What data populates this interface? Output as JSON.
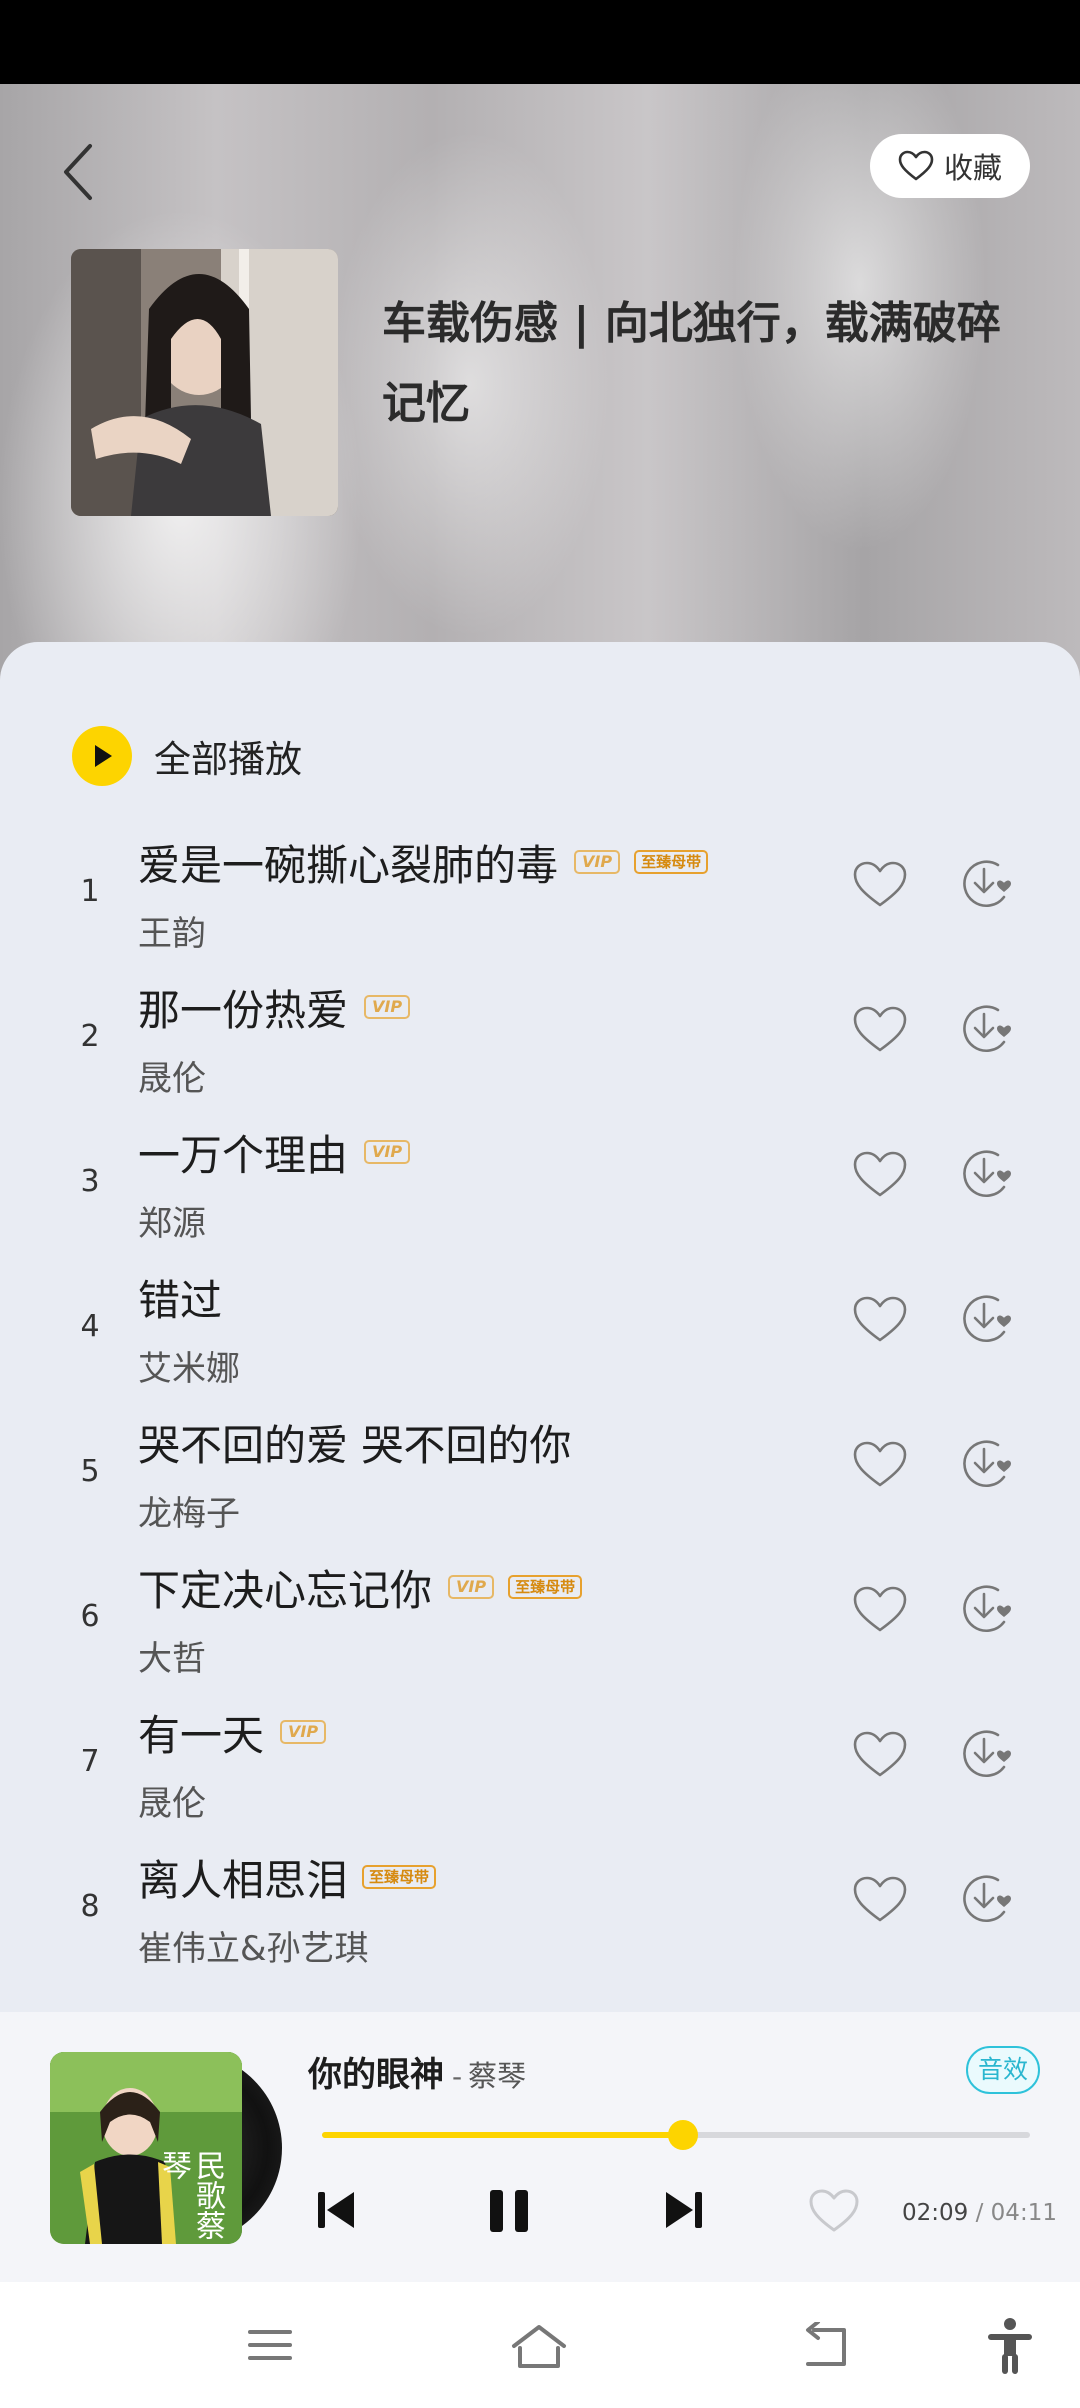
{
  "header": {
    "favorite_label": "收藏",
    "playlist_title": "车载伤感 | 向北独行，载满破碎记忆"
  },
  "list": {
    "play_all_label": "全部播放",
    "songs": [
      {
        "index": "1",
        "title": "爱是一碗撕心裂肺的毒",
        "artist": "王韵",
        "vip": "VIP",
        "master": "至臻母带"
      },
      {
        "index": "2",
        "title": "那一份热爱",
        "artist": "晟伦",
        "vip": "VIP",
        "master": ""
      },
      {
        "index": "3",
        "title": "一万个理由",
        "artist": "郑源",
        "vip": "VIP",
        "master": ""
      },
      {
        "index": "4",
        "title": "错过",
        "artist": "艾米娜",
        "vip": "",
        "master": ""
      },
      {
        "index": "5",
        "title": "哭不回的爱 哭不回的你",
        "artist": "龙梅子",
        "vip": "",
        "master": ""
      },
      {
        "index": "6",
        "title": "下定决心忘记你",
        "artist": "大哲",
        "vip": "VIP",
        "master": "至臻母带"
      },
      {
        "index": "7",
        "title": "有一天",
        "artist": "晟伦",
        "vip": "VIP",
        "master": ""
      },
      {
        "index": "8",
        "title": "离人相思泪",
        "artist": "崔伟立&孙艺琪",
        "vip": "",
        "master": "至臻母带"
      }
    ]
  },
  "player": {
    "song": "你的眼神",
    "separator": "-",
    "artist": "蔡琴",
    "album_text": "民歌蔡琴",
    "effect_label": "音效",
    "progress": 0.51,
    "current_time": "02:09",
    "time_separator": "/",
    "total_time": "04:11",
    "accent_color": "#fdd400"
  }
}
